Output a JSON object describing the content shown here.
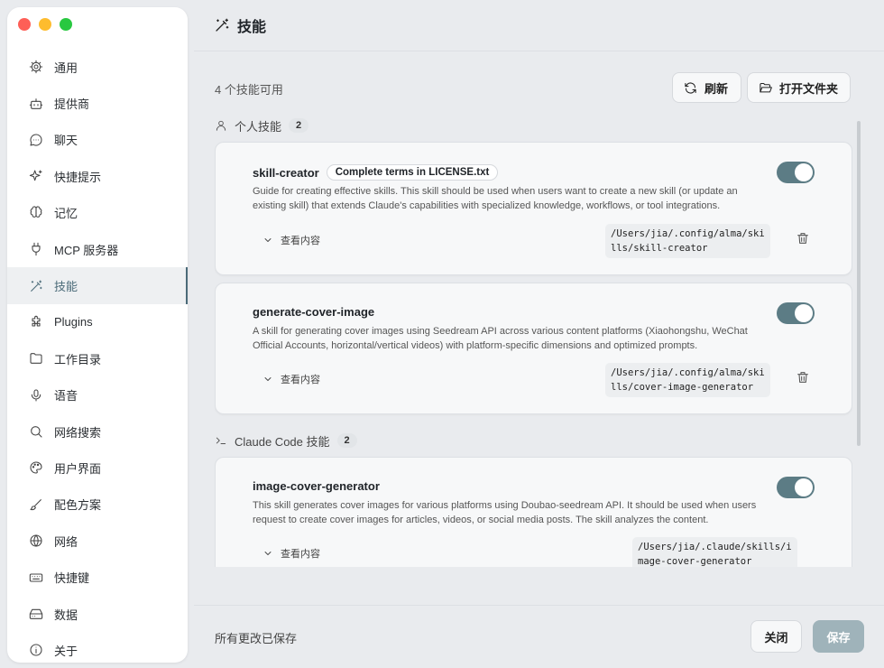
{
  "window": {
    "controls": [
      "close",
      "minimize",
      "zoom"
    ]
  },
  "sidebar": {
    "items": [
      {
        "label": "通用",
        "icon": "gear-icon"
      },
      {
        "label": "提供商",
        "icon": "bot-icon"
      },
      {
        "label": "聊天",
        "icon": "chat-bubble-icon"
      },
      {
        "label": "快捷提示",
        "icon": "sparkles-icon"
      },
      {
        "label": "记忆",
        "icon": "brain-icon"
      },
      {
        "label": "MCP 服务器",
        "icon": "plug-icon"
      },
      {
        "label": "技能",
        "icon": "magic-wand-icon",
        "active": true
      },
      {
        "label": "Plugins",
        "icon": "puzzle-icon"
      },
      {
        "label": "工作目录",
        "icon": "folder-icon"
      },
      {
        "label": "语音",
        "icon": "microphone-icon"
      },
      {
        "label": "网络搜索",
        "icon": "search-icon"
      },
      {
        "label": "用户界面",
        "icon": "palette-icon"
      },
      {
        "label": "配色方案",
        "icon": "brush-icon"
      },
      {
        "label": "网络",
        "icon": "globe-icon"
      },
      {
        "label": "快捷键",
        "icon": "keyboard-icon"
      },
      {
        "label": "数据",
        "icon": "hard-drive-icon"
      },
      {
        "label": "关于",
        "icon": "info-icon"
      }
    ]
  },
  "header": {
    "title": "技能",
    "icon": "magic-wand-icon"
  },
  "toolbar": {
    "count_label": "4 个技能可用",
    "refresh_label": "刷新",
    "open_folder_label": "打开文件夹"
  },
  "sections": [
    {
      "title": "个人技能",
      "count": "2",
      "icon": "user-icon",
      "skills": [
        {
          "name": "skill-creator",
          "tag": "Complete terms in LICENSE.txt",
          "description": "Guide for creating effective skills. This skill should be used when users want to create a new skill (or update an existing skill) that extends Claude's capabilities with specialized knowledge, workflows, or tool integrations.",
          "enabled": true,
          "view_label": "查看内容",
          "path": "/Users/jia/.config/alma/skills/skill-creator",
          "path_display": "/Users/jia/.config/alma/ski\nlls/skill-creator"
        },
        {
          "name": "generate-cover-image",
          "tag": "",
          "description": "A skill for generating cover images using Seedream API across various content platforms (Xiaohongshu, WeChat Official Accounts, horizontal/vertical videos) with platform-specific dimensions and optimized prompts.",
          "enabled": true,
          "view_label": "查看内容",
          "path": "/Users/jia/.config/alma/skills/cover-image-generator",
          "path_display": "/Users/jia/.config/alma/ski\nlls/cover-image-generator"
        }
      ]
    },
    {
      "title": "Claude Code 技能",
      "count": "2",
      "icon": "terminal-icon",
      "skills": [
        {
          "name": "image-cover-generator",
          "tag": "",
          "description": "This skill generates cover images for various platforms using Doubao-seedream API. It should be used when users request to create cover images for articles, videos, or social media posts. The skill analyzes the content.",
          "enabled": true,
          "view_label": "查看内容",
          "path": "/Users/jia/.claude/skills/image-cover-generator",
          "path_display": "/Users/jia/.claude/skills/i\nmage-cover-generator"
        }
      ]
    }
  ],
  "footer": {
    "status": "所有更改已保存",
    "close_label": "关闭",
    "save_label": "保存"
  }
}
